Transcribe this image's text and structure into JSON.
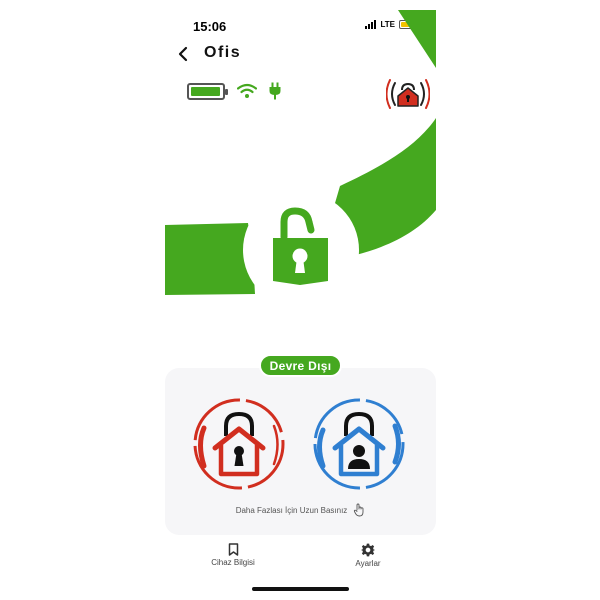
{
  "status_bar": {
    "time": "15:06",
    "network": "LTE"
  },
  "header": {
    "title": "Ofis",
    "back_icon": "chevron-left-icon"
  },
  "indicators": {
    "battery_level": 0.9,
    "wifi_icon": "wifi-icon",
    "power_icon": "plug-icon",
    "alarm_icon": "house-alarm-icon"
  },
  "main": {
    "status_label": "Devre Dışı",
    "state_icon": "unlocked-padlock-icon"
  },
  "actions": {
    "arm_icon": "house-lock-red-icon",
    "home_icon": "house-lock-blue-icon",
    "hint": "Daha Fazlası İçin Uzun Basınız",
    "hint_icon": "long-press-hand-icon"
  },
  "tabs": [
    {
      "label": "Cihaz Bilgisi",
      "icon": "bookmark-icon"
    },
    {
      "label": "Ayarlar",
      "icon": "gear-icon"
    }
  ],
  "colors": {
    "accent": "#45a81f",
    "arm_red": "#d12e1f",
    "home_blue": "#2f7fd1",
    "dark": "#111111"
  }
}
